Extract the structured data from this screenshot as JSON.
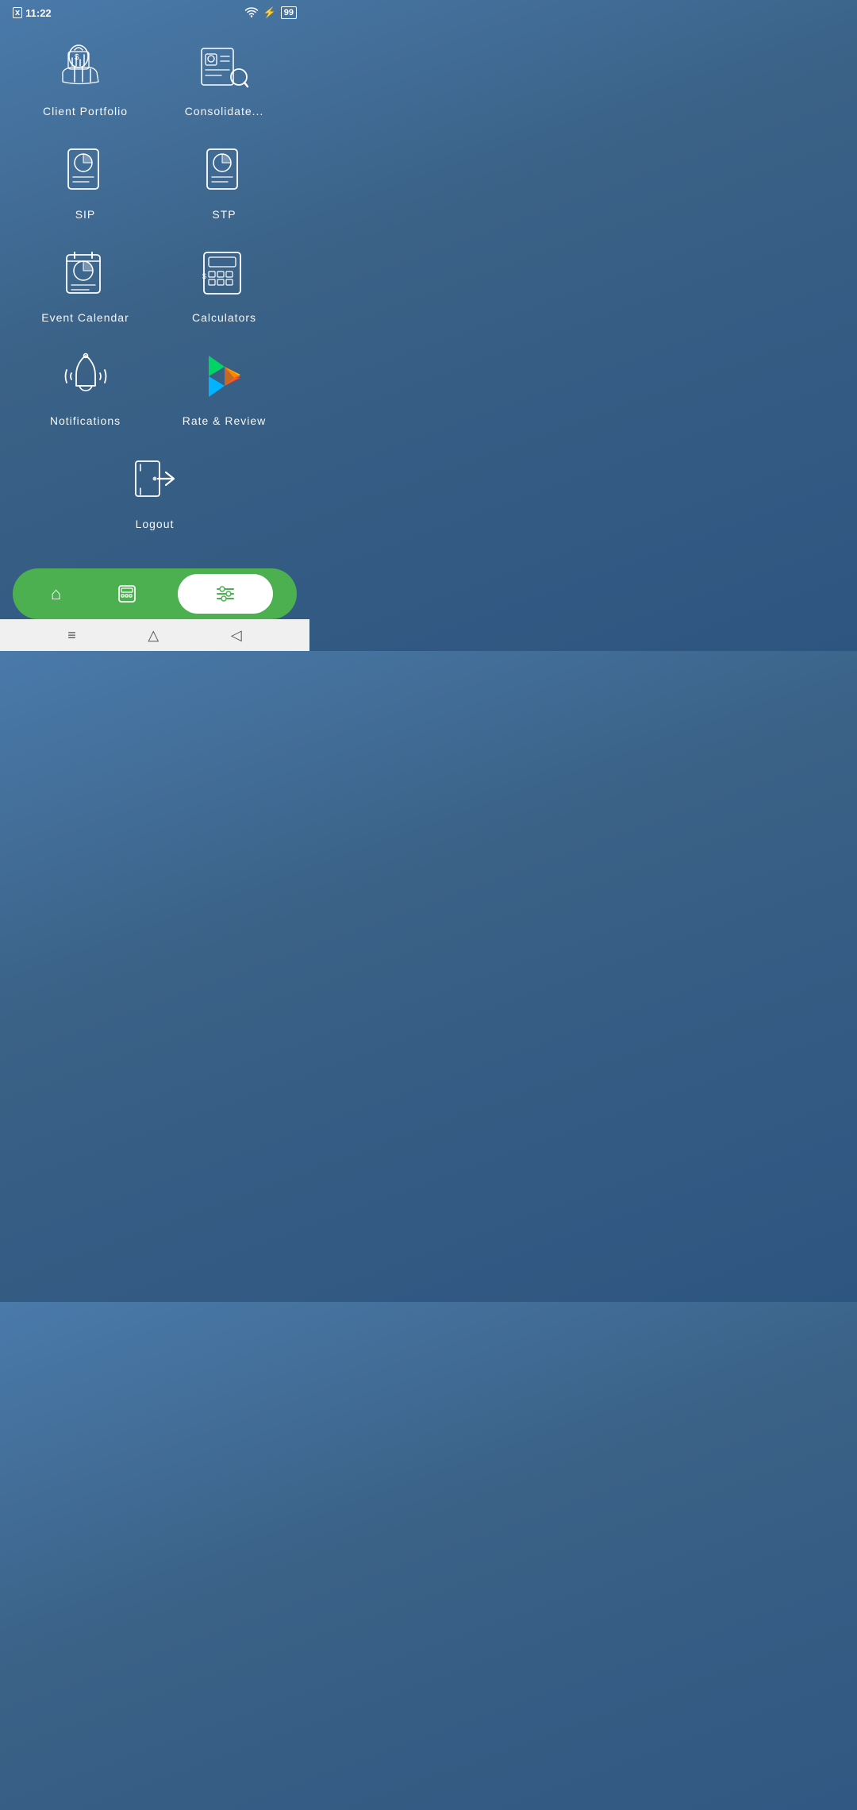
{
  "statusBar": {
    "time": "11:22",
    "battery": "99",
    "xLabel": "x"
  },
  "menuItems": [
    {
      "id": "client-portfolio",
      "label": "Client Portfolio",
      "icon": "briefcase-money"
    },
    {
      "id": "consolidate",
      "label": "Consolidate...",
      "icon": "consolidate"
    },
    {
      "id": "sip",
      "label": "SIP",
      "icon": "chart-doc"
    },
    {
      "id": "stp",
      "label": "STP",
      "icon": "chart-doc-2"
    },
    {
      "id": "event-calendar",
      "label": "Event Calendar",
      "icon": "calendar"
    },
    {
      "id": "calculators",
      "label": "Calculators",
      "icon": "calculator"
    },
    {
      "id": "notifications",
      "label": "Notifications",
      "icon": "bell"
    },
    {
      "id": "rate-review",
      "label": "Rate & Review",
      "icon": "play-store"
    }
  ],
  "logout": {
    "label": "Logout",
    "icon": "logout"
  },
  "bottomNav": {
    "home": "home",
    "calculator": "calculator",
    "settings": "settings"
  },
  "systemNav": {
    "menu": "≡",
    "home": "⌂",
    "back": "↩"
  },
  "colors": {
    "background": "#3a6186",
    "navGreen": "#4caf50",
    "white": "#ffffff"
  }
}
